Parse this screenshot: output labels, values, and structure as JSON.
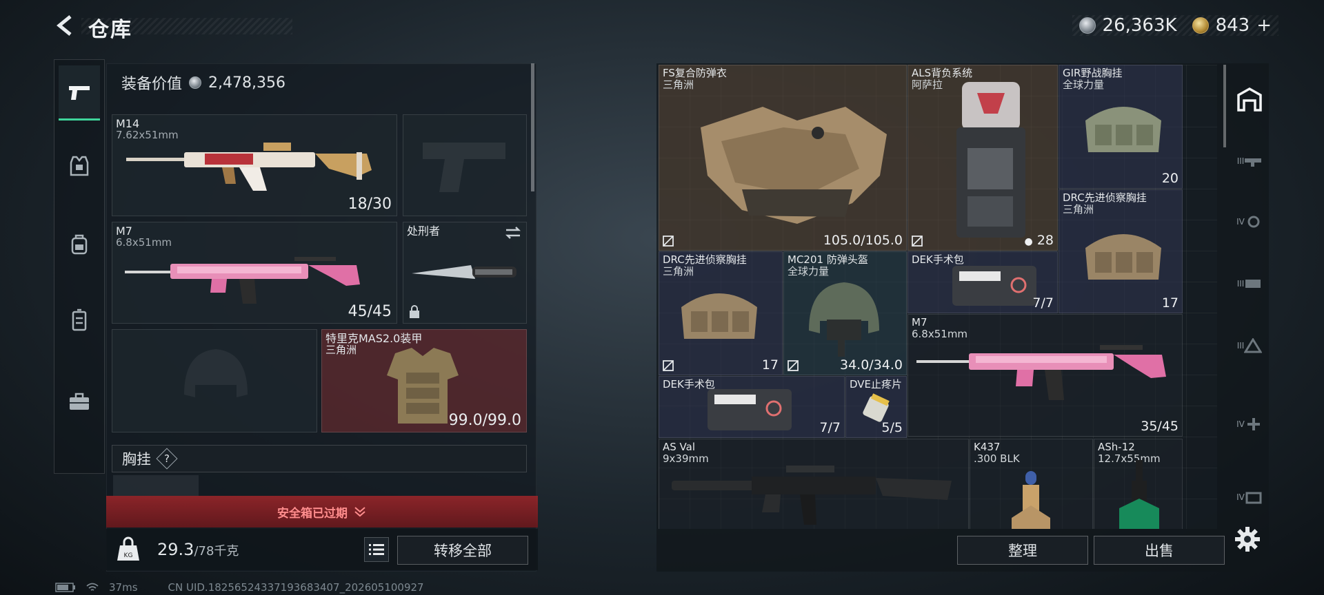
{
  "header": {
    "title": "仓库",
    "silver_amount": "26,363K",
    "gold_amount": "843",
    "gold_plus": "+"
  },
  "left": {
    "equip_value_label": "装备价值",
    "equip_value": "2,478,356",
    "slots": {
      "primary": {
        "name": "M14",
        "caliber": "7.62x51mm",
        "count": "18/30"
      },
      "secondary": {
        "name": "M7",
        "caliber": "6.8x51mm",
        "count": "45/45"
      },
      "melee": {
        "name": "处刑者"
      },
      "armor": {
        "name": "特里克MAS2.0装甲",
        "sub": "三角洲",
        "count": "99.0/99.0"
      }
    },
    "chest_label": "胸挂",
    "chest_help": "?",
    "safe_box_text": "安全箱已过期",
    "weight_current": "29.3",
    "weight_max": "/78千克",
    "transfer_all": "转移全部"
  },
  "stash": {
    "items": [
      {
        "id": "fs-vest",
        "name": "FS复合防弹衣",
        "sub": "三角洲",
        "count": "105.0/105.0"
      },
      {
        "id": "als-pack",
        "name": "ALS背负系统",
        "sub": "阿萨拉",
        "count": "28"
      },
      {
        "id": "gir-rig",
        "name": "GIR野战胸挂",
        "sub": "全球力量",
        "count": "20"
      },
      {
        "id": "drc-rig-1",
        "name": "DRC先进侦察胸挂",
        "sub": "三角洲",
        "count": "17"
      },
      {
        "id": "drc-rig-2",
        "name": "DRC先进侦察胸挂",
        "sub": "三角洲",
        "count": "17"
      },
      {
        "id": "mc201",
        "name": "MC201 防弹头盔",
        "sub": "全球力量",
        "count": "34.0/34.0"
      },
      {
        "id": "dek-1",
        "name": "DEK手术包",
        "count": "7/7"
      },
      {
        "id": "m7",
        "name": "M7",
        "sub": "6.8x51mm",
        "count": "35/45"
      },
      {
        "id": "dek-2",
        "name": "DEK手术包",
        "count": "7/7"
      },
      {
        "id": "dve",
        "name": "DVE止疼片",
        "count": "5/5"
      },
      {
        "id": "asval",
        "name": "AS Val",
        "sub": "9x39mm"
      },
      {
        "id": "k437",
        "name": "K437",
        "sub": ".300 BLK"
      },
      {
        "id": "ash12",
        "name": "ASh-12",
        "sub": "12.7x55mm"
      }
    ],
    "sort_button": "整理",
    "sell_button": "出售"
  },
  "right_rail": {
    "tiers": [
      "III",
      "IV",
      "III",
      "III",
      "IV",
      "IV"
    ]
  },
  "status": {
    "ping": "37ms",
    "uid": "CN UID.18256524337193683407_202605100927"
  },
  "colors": {
    "accent_green": "#3fd59b",
    "alert_red": "#ff8d8d",
    "brown_tile": "#5c4836",
    "navy_tile": "#2e344e"
  }
}
